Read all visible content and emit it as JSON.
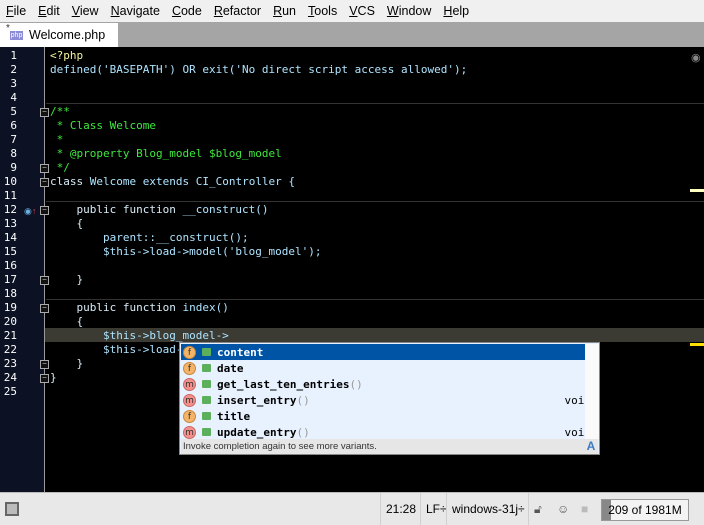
{
  "menu": [
    "File",
    "Edit",
    "View",
    "Navigate",
    "Code",
    "Refactor",
    "Run",
    "Tools",
    "VCS",
    "Window",
    "Help"
  ],
  "tab": {
    "label": "Welcome.php",
    "modified": "*",
    "icon": "php"
  },
  "editor": {
    "current_line": 21,
    "lines": [
      [
        [
          "<?php",
          "tag"
        ]
      ],
      [
        [
          "defined('BASEPATH') OR exit('No direct script access allowed');",
          "str"
        ]
      ],
      [],
      [],
      [
        [
          "/**",
          "com"
        ]
      ],
      [
        [
          " * Class Welcome",
          "com"
        ]
      ],
      [
        [
          " *",
          "com"
        ]
      ],
      [
        [
          " * @property Blog_model $blog_model",
          "com"
        ]
      ],
      [
        [
          " */",
          "com"
        ]
      ],
      [
        [
          "class ",
          "kw"
        ],
        [
          "Welcome extends CI_Controller {",
          "str"
        ]
      ],
      [],
      [
        [
          "    public function ",
          "kw"
        ],
        [
          "__construct()",
          "str"
        ]
      ],
      [
        [
          "    {",
          "kw"
        ]
      ],
      [
        [
          "        parent::__construct();",
          "str"
        ]
      ],
      [
        [
          "        $this->load->model('blog_model');",
          "str"
        ]
      ],
      [],
      [
        [
          "    }",
          "kw"
        ]
      ],
      [],
      [
        [
          "    public function ",
          "kw"
        ],
        [
          "index()",
          "str"
        ]
      ],
      [
        [
          "    {",
          "kw"
        ]
      ],
      [
        [
          "        $this->blog_model->",
          "str"
        ]
      ],
      [
        [
          "        $this->load->v",
          "str"
        ]
      ],
      [
        [
          "    }",
          "kw"
        ]
      ],
      [
        [
          "}",
          "kw"
        ]
      ],
      []
    ]
  },
  "completion": {
    "items": [
      {
        "kind": "f",
        "name": "content",
        "params": "",
        "type": ""
      },
      {
        "kind": "f",
        "name": "date",
        "params": "",
        "type": ""
      },
      {
        "kind": "m",
        "name": "get_last_ten_entries",
        "params": "()",
        "type": ""
      },
      {
        "kind": "m",
        "name": "insert_entry",
        "params": "()",
        "type": "void"
      },
      {
        "kind": "f",
        "name": "title",
        "params": "",
        "type": ""
      },
      {
        "kind": "m",
        "name": "update_entry",
        "params": "()",
        "type": "void"
      }
    ],
    "hint": "Invoke completion again to see more variants.",
    "hint_icon": "A"
  },
  "status": {
    "position": "21:28",
    "line_sep": "LF÷",
    "encoding": "windows-31j÷",
    "memory": "209 of 1981M",
    "memory_fraction": 0.105
  }
}
